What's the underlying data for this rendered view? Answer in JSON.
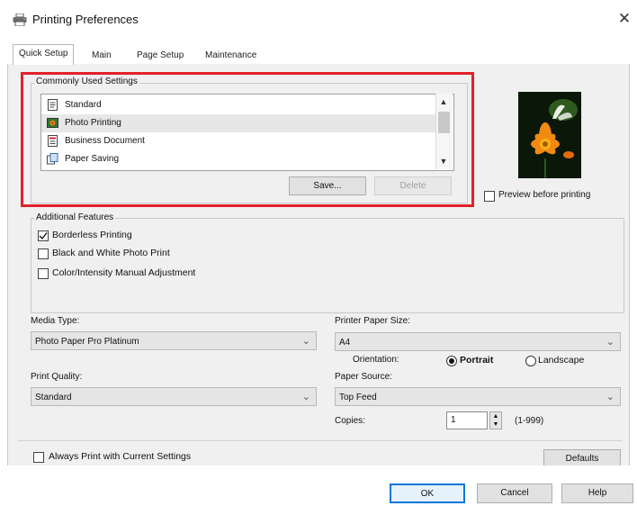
{
  "window": {
    "title": "Printing Preferences",
    "close_glyph": "✕"
  },
  "tabs": [
    {
      "label": "Quick Setup",
      "active": true
    },
    {
      "label": "Main"
    },
    {
      "label": "Page Setup"
    },
    {
      "label": "Maintenance"
    }
  ],
  "commonly_used": {
    "label": "Commonly Used Settings",
    "items": [
      {
        "label": "Standard",
        "icon": "standard-doc-icon"
      },
      {
        "label": "Photo Printing",
        "icon": "photo-icon",
        "selected": true
      },
      {
        "label": "Business Document",
        "icon": "business-doc-icon"
      },
      {
        "label": "Paper Saving",
        "icon": "paper-saving-icon"
      }
    ],
    "save_label": "Save...",
    "delete_label": "Delete"
  },
  "preview": {
    "checkbox_label": "Preview before printing",
    "checked": false
  },
  "additional_features": {
    "label": "Additional Features",
    "options": [
      {
        "label": "Borderless Printing",
        "checked": true
      },
      {
        "label": "Black and White Photo Print",
        "checked": false
      },
      {
        "label": "Color/Intensity Manual Adjustment",
        "checked": false
      }
    ]
  },
  "media_type": {
    "label": "Media Type:",
    "value": "Photo Paper Pro Platinum"
  },
  "print_quality": {
    "label": "Print Quality:",
    "value": "Standard"
  },
  "printer_paper_size": {
    "label": "Printer Paper Size:",
    "value": "A4"
  },
  "orientation": {
    "label": "Orientation:",
    "portrait": "Portrait",
    "landscape": "Landscape",
    "selected": "Portrait"
  },
  "paper_source": {
    "label": "Paper Source:",
    "value": "Top Feed"
  },
  "copies": {
    "label": "Copies:",
    "value": "1",
    "range": "(1-999)"
  },
  "always_print": {
    "label": "Always Print with Current Settings",
    "checked": false
  },
  "buttons": {
    "defaults": "Defaults",
    "ok": "OK",
    "cancel": "Cancel",
    "help": "Help"
  },
  "colors": {
    "highlight": "#e2202b",
    "focus": "#0078d7"
  }
}
